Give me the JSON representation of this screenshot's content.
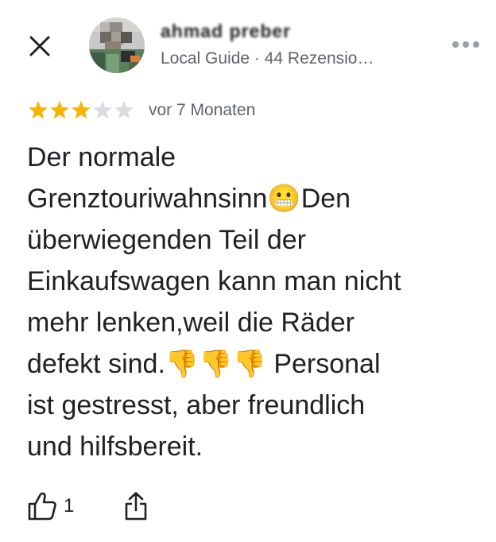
{
  "header": {
    "close_icon": "close-icon",
    "author_name": "ahmad preber",
    "author_meta": "Local Guide · 44 Rezensio…",
    "more_icon": "more-horizontal-icon"
  },
  "review": {
    "rating": 3,
    "rating_max": 5,
    "date": "vor 7 Monaten",
    "text": "Der normale\nGrenztouriwahnsinn😬Den\nüberwiegenden Teil der\nEinkaufswagen kann man nicht\nmehr lenken,weil die Räder\ndefekt sind.👎👎👎 Personal\nist gestresst, aber freundlich\nund hilfsbereit."
  },
  "actions": {
    "like_icon": "thumbs-up-icon",
    "like_count": "1",
    "share_icon": "share-icon"
  },
  "colors": {
    "star_filled": "#F6B400",
    "star_empty": "#DADCE0",
    "text_primary": "#202124",
    "text_secondary": "#5F6368"
  }
}
